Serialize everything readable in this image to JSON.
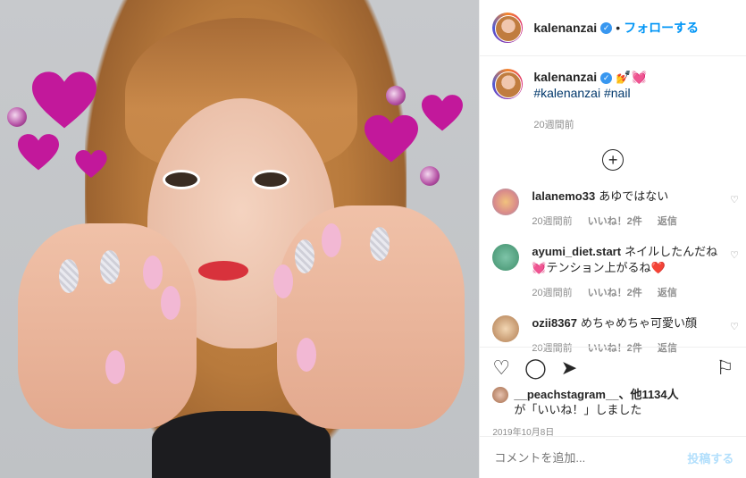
{
  "post": {
    "username": "kalenanzai",
    "follow_label": "フォローする",
    "dot": "•",
    "caption_emoji": "💅💓",
    "hashtags": "#kalenanzai #nail",
    "caption_time": "20週間前",
    "load_more": "+"
  },
  "comments": [
    {
      "user": "lalanemo33",
      "text": "あゆではない",
      "time": "20週間前",
      "likes": "いいね！2件",
      "reply": "返信"
    },
    {
      "user": "ayumi_diet.start",
      "text": "ネイルしたんだね💓テンション上がるね❤️",
      "time": "20週間前",
      "likes": "いいね！2件",
      "reply": "返信"
    },
    {
      "user": "ozii8367",
      "text": "めちゃめちゃ可愛い顔",
      "time": "20週間前",
      "likes": "いいね！2件",
      "reply": "返信"
    }
  ],
  "likes": {
    "user": "__peachstagram__",
    "text": "、他1134人",
    "suffix": "が「いいね！」しました"
  },
  "date": "2019年10月8日",
  "composer": {
    "placeholder": "コメントを追加...",
    "post_label": "投稿する"
  },
  "colors": {
    "link_blue": "#0095f6",
    "verified_blue": "#3897f0",
    "heart_pink": "#c2189b"
  }
}
